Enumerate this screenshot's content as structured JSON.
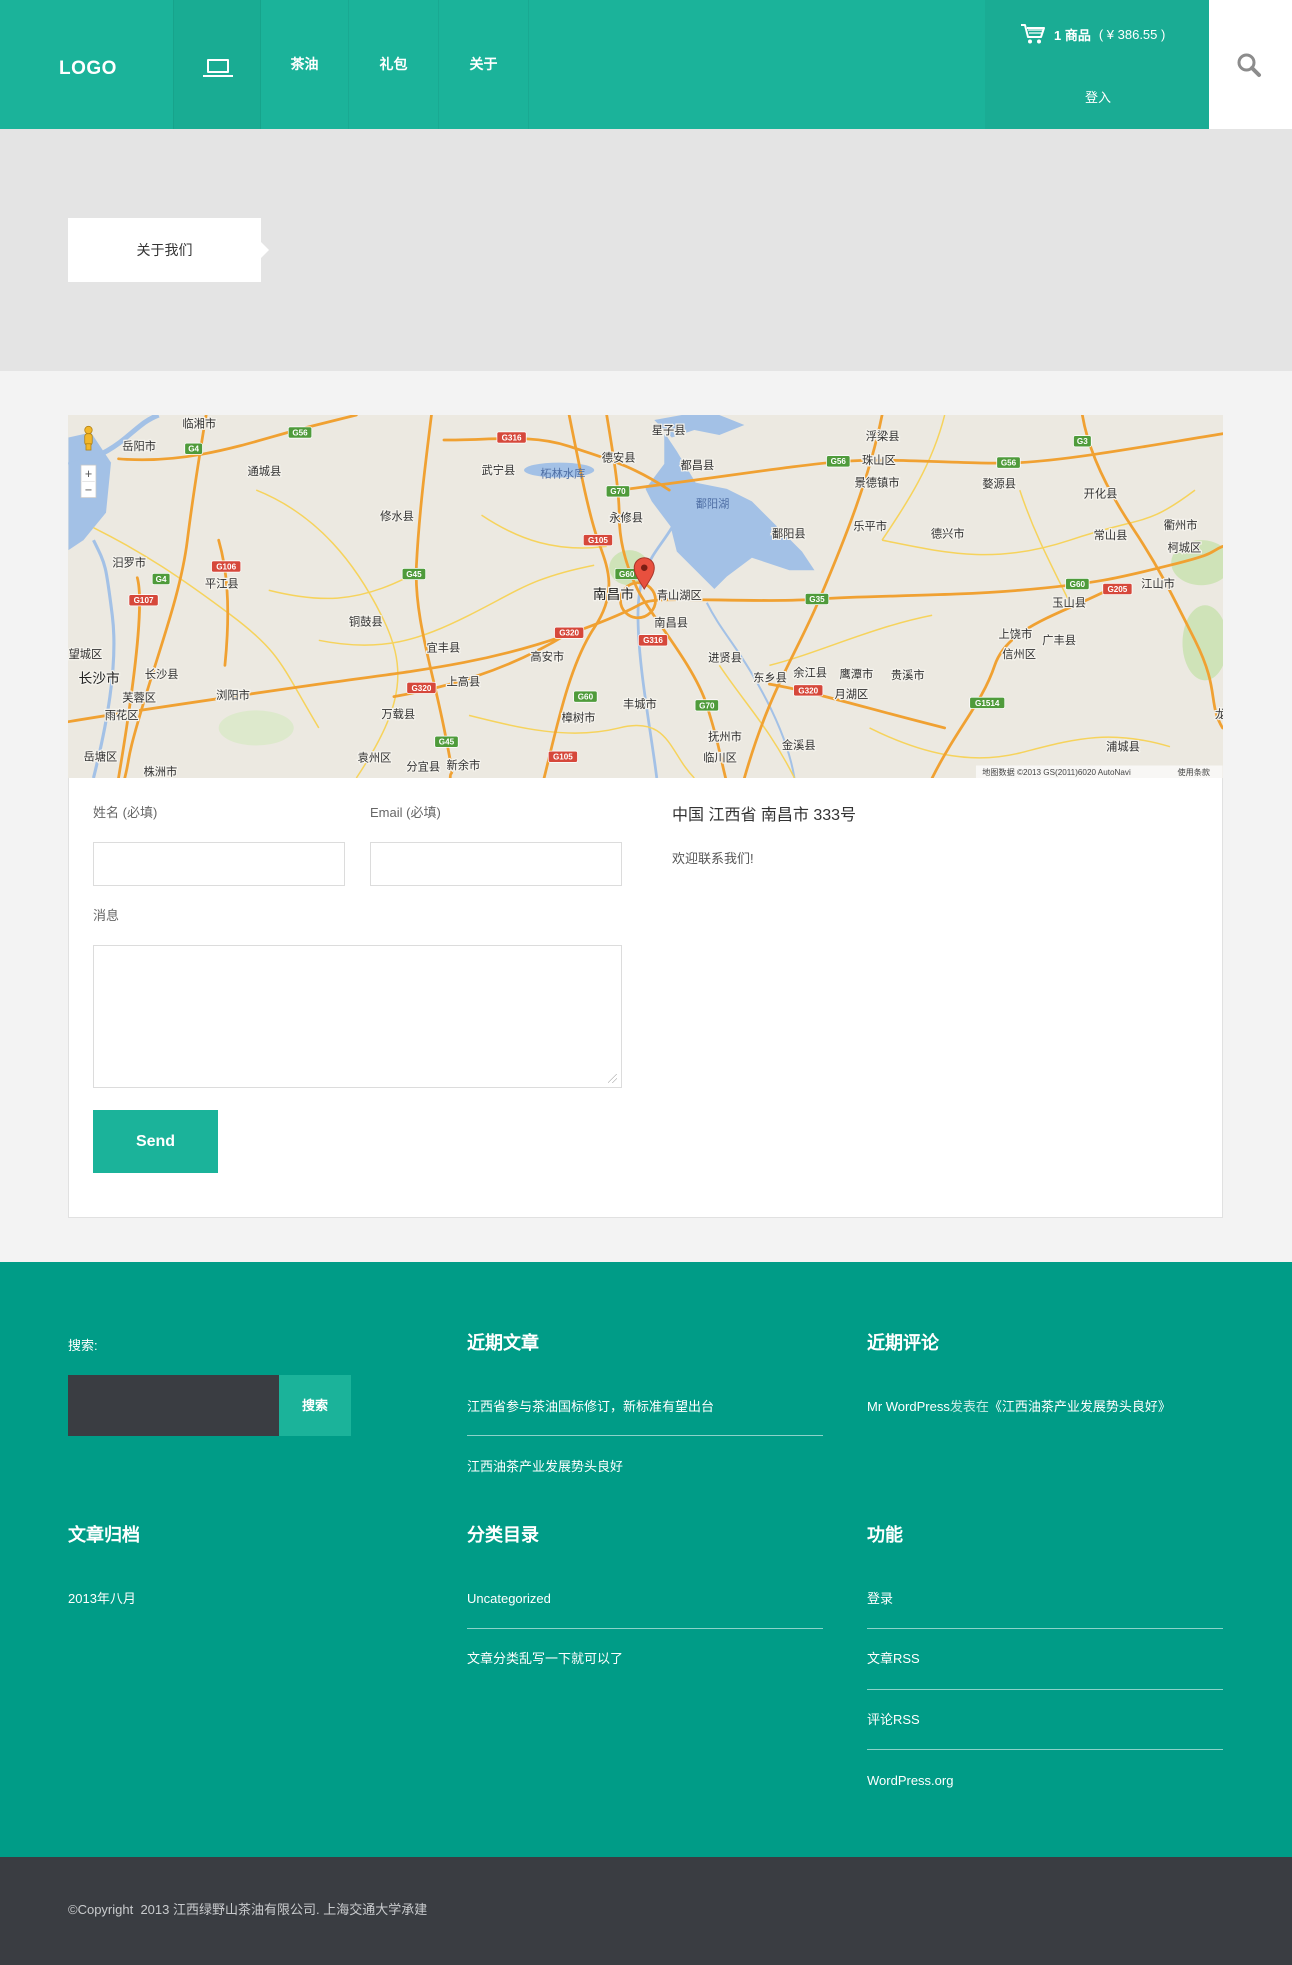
{
  "colors": {
    "brand": "#1bb39a",
    "footer": "#009c87",
    "dark": "#3a3d42",
    "banner": "#e4e4e4"
  },
  "header": {
    "logo": "LOGO",
    "home_icon": "laptop-icon",
    "nav": [
      {
        "label": "茶油"
      },
      {
        "label": "礼包"
      },
      {
        "label": "关于"
      }
    ],
    "cart": {
      "icon": "cart-icon",
      "count": "1 商品",
      "total": "( ¥ 386.55 )"
    },
    "login": "登入",
    "search_icon": "search-icon"
  },
  "breadcrumb": {
    "current": "关于我们"
  },
  "map": {
    "labels": [
      "临湘市",
      "岳阳市",
      "通城县",
      "武宁县",
      "德安县",
      "星子县",
      "都昌县",
      "浮梁县",
      "珠山区",
      "景德镇市",
      "婺源县",
      "开化县",
      "修水县",
      "永修县",
      "乐平市",
      "鄱阳县",
      "德兴市",
      "常山县",
      "衢州市",
      "柯城区",
      "汨罗市",
      "平江县",
      "南昌市",
      "青山湖区",
      "江山市",
      "玉山县",
      "铜鼓县",
      "南昌县",
      "上饶市",
      "广丰县",
      "宜丰县",
      "高安市",
      "进贤县",
      "信州区",
      "望城区",
      "长沙县",
      "长沙市",
      "东乡县",
      "余江县",
      "鹰潭市",
      "贵溪市",
      "上高县",
      "浏阳市",
      "芙蓉区",
      "月湖区",
      "丰城市",
      "雨花区",
      "万载县",
      "樟树市",
      "抚州市",
      "金溪县",
      "浦城县",
      "岳塘区",
      "株洲市",
      "袁州区",
      "分宜县",
      "新余市",
      "临川区",
      "龙"
    ],
    "water_labels": [
      "柘林水库",
      "鄱阳湖"
    ],
    "highways": [
      {
        "code": "G4",
        "color": "#4f9b3b"
      },
      {
        "code": "G56",
        "color": "#4f9b3b"
      },
      {
        "code": "G316",
        "color": "#d6483b"
      },
      {
        "code": "G56",
        "color": "#4f9b3b"
      },
      {
        "code": "G56",
        "color": "#4f9b3b"
      },
      {
        "code": "G3",
        "color": "#4f9b3b"
      },
      {
        "code": "G70",
        "color": "#4f9b3b"
      },
      {
        "code": "G105",
        "color": "#d6483b"
      },
      {
        "code": "G106",
        "color": "#d6483b"
      },
      {
        "code": "G4",
        "color": "#4f9b3b"
      },
      {
        "code": "G45",
        "color": "#4f9b3b"
      },
      {
        "code": "G60",
        "color": "#4f9b3b"
      },
      {
        "code": "G35",
        "color": "#4f9b3b"
      },
      {
        "code": "G60",
        "color": "#4f9b3b"
      },
      {
        "code": "G205",
        "color": "#d6483b"
      },
      {
        "code": "G107",
        "color": "#d6483b"
      },
      {
        "code": "G320",
        "color": "#d6483b"
      },
      {
        "code": "G316",
        "color": "#d6483b"
      },
      {
        "code": "G320",
        "color": "#d6483b"
      },
      {
        "code": "G60",
        "color": "#4f9b3b"
      },
      {
        "code": "G320",
        "color": "#d6483b"
      },
      {
        "code": "G70",
        "color": "#4f9b3b"
      },
      {
        "code": "G1514",
        "color": "#4f9b3b"
      },
      {
        "code": "G45",
        "color": "#4f9b3b"
      },
      {
        "code": "G105",
        "color": "#d6483b"
      }
    ],
    "zoom_in": "+",
    "zoom_out": "−",
    "attribution": "地图数据 ©2013 GS(2011)6020 AutoNavi",
    "terms": "使用条款",
    "marker_icon": "map-marker-icon",
    "pegman_icon": "pegman-icon"
  },
  "contact": {
    "name_label": "姓名 (必填)",
    "email_label": "Email (必填)",
    "message_label": "消息",
    "send_label": "Send",
    "address": "中国 江西省 南昌市 333号",
    "welcome": "欢迎联系我们!"
  },
  "footer": {
    "search": {
      "label": "搜索:",
      "button": "搜索"
    },
    "recent_posts": {
      "title": "近期文章",
      "items": [
        "江西省参与茶油国标修订，新标准有望出台",
        "江西油茶产业发展势头良好"
      ]
    },
    "recent_comments": {
      "title": "近期评论",
      "author": "Mr WordPress",
      "connector": "发表在",
      "post": "《江西油茶产业发展势头良好》"
    },
    "archives": {
      "title": "文章归档",
      "items": [
        "2013年八月"
      ]
    },
    "categories": {
      "title": "分类目录",
      "items": [
        "Uncategorized",
        "文章分类乱写一下就可以了"
      ]
    },
    "meta": {
      "title": "功能",
      "items": [
        "登录",
        "文章RSS",
        "评论RSS",
        "WordPress.org"
      ]
    }
  },
  "copyright": "©Copyright  2013 江西绿野山茶油有限公司. 上海交通大学承建"
}
